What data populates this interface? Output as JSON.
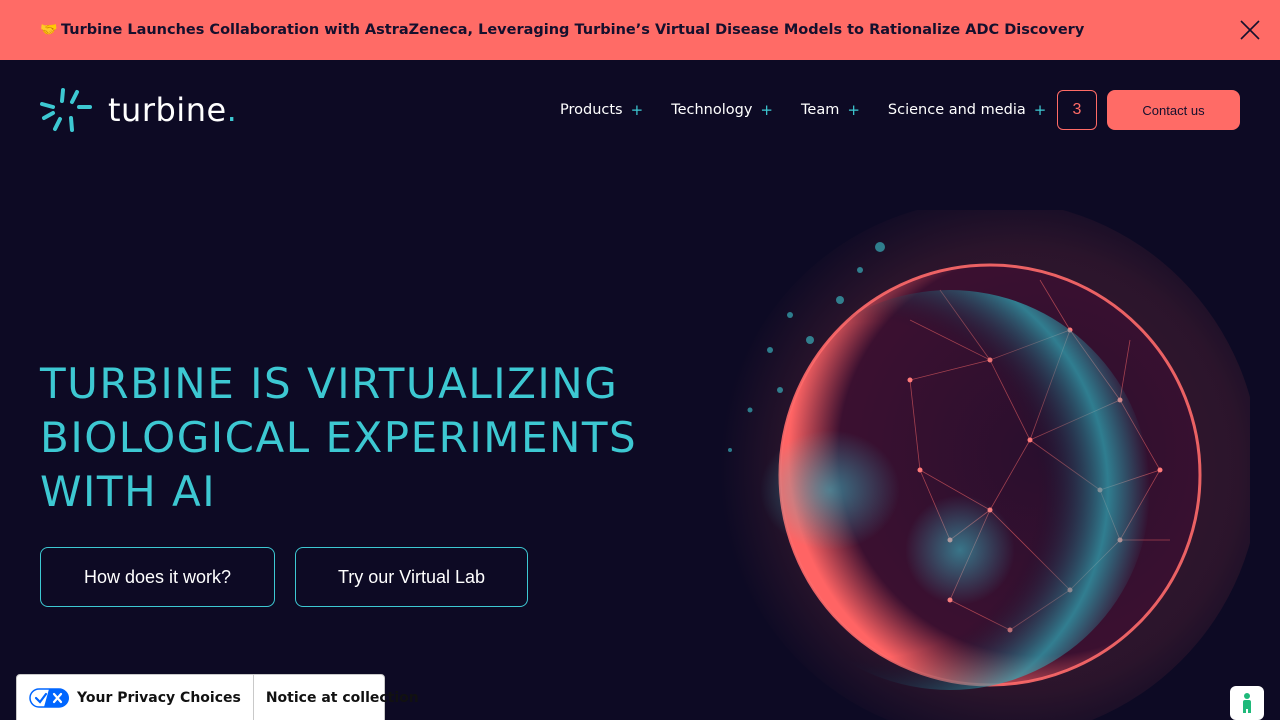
{
  "announcement": {
    "emoji": "🤝",
    "text": "Turbine Launches Collaboration with AstraZeneca, Leveraging Turbine’s Virtual Disease Models to Rationalize ADC Discovery",
    "close_icon": "close-icon"
  },
  "logo": {
    "text": "turbine",
    "dot": "."
  },
  "nav": {
    "items": [
      {
        "label": "Products",
        "expand": "+"
      },
      {
        "label": "Technology",
        "expand": "+"
      },
      {
        "label": "Team",
        "expand": "+"
      },
      {
        "label": "Science and media",
        "expand": "+"
      }
    ],
    "counter": "3",
    "contact_label": "Contact us"
  },
  "hero": {
    "title_lines": [
      "TURBINE IS VIRTUALIZING",
      "BIOLOGICAL EXPERIMENTS",
      "WITH AI"
    ],
    "how_label": "How does it work?",
    "lab_label": "Try our Virtual Lab"
  },
  "privacy": {
    "choices_label": "Your Privacy Choices",
    "notice_label": "Notice at collection"
  },
  "colors": {
    "background": "#0d0a24",
    "accent_coral": "#ff6b66",
    "accent_teal": "#3dc8d2"
  }
}
